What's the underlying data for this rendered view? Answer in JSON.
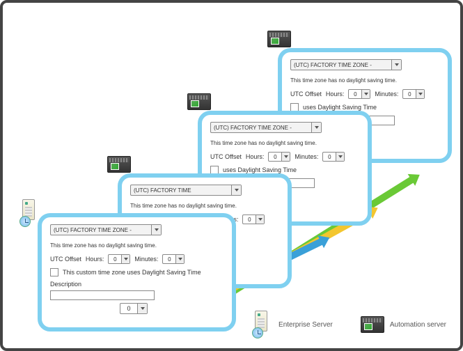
{
  "panel": {
    "tz_label": "(UTC) FACTORY TIME ZONE -",
    "note": "This time zone has no daylight saving time.",
    "offset_label": "UTC Offset",
    "hours_label": "Hours:",
    "hours_value": "0",
    "minutes_label": "Minutes:",
    "minutes_value": "0",
    "dst_full": "This custom time zone uses Daylight Saving Time",
    "dst_short": "uses Daylight Saving Time",
    "description_label": "Description",
    "big_value": "0"
  },
  "panel2_tz": "(UTC) FACTORY TIME",
  "legend": {
    "enterprise": "Enterprise Server",
    "automation": "Automation server"
  }
}
